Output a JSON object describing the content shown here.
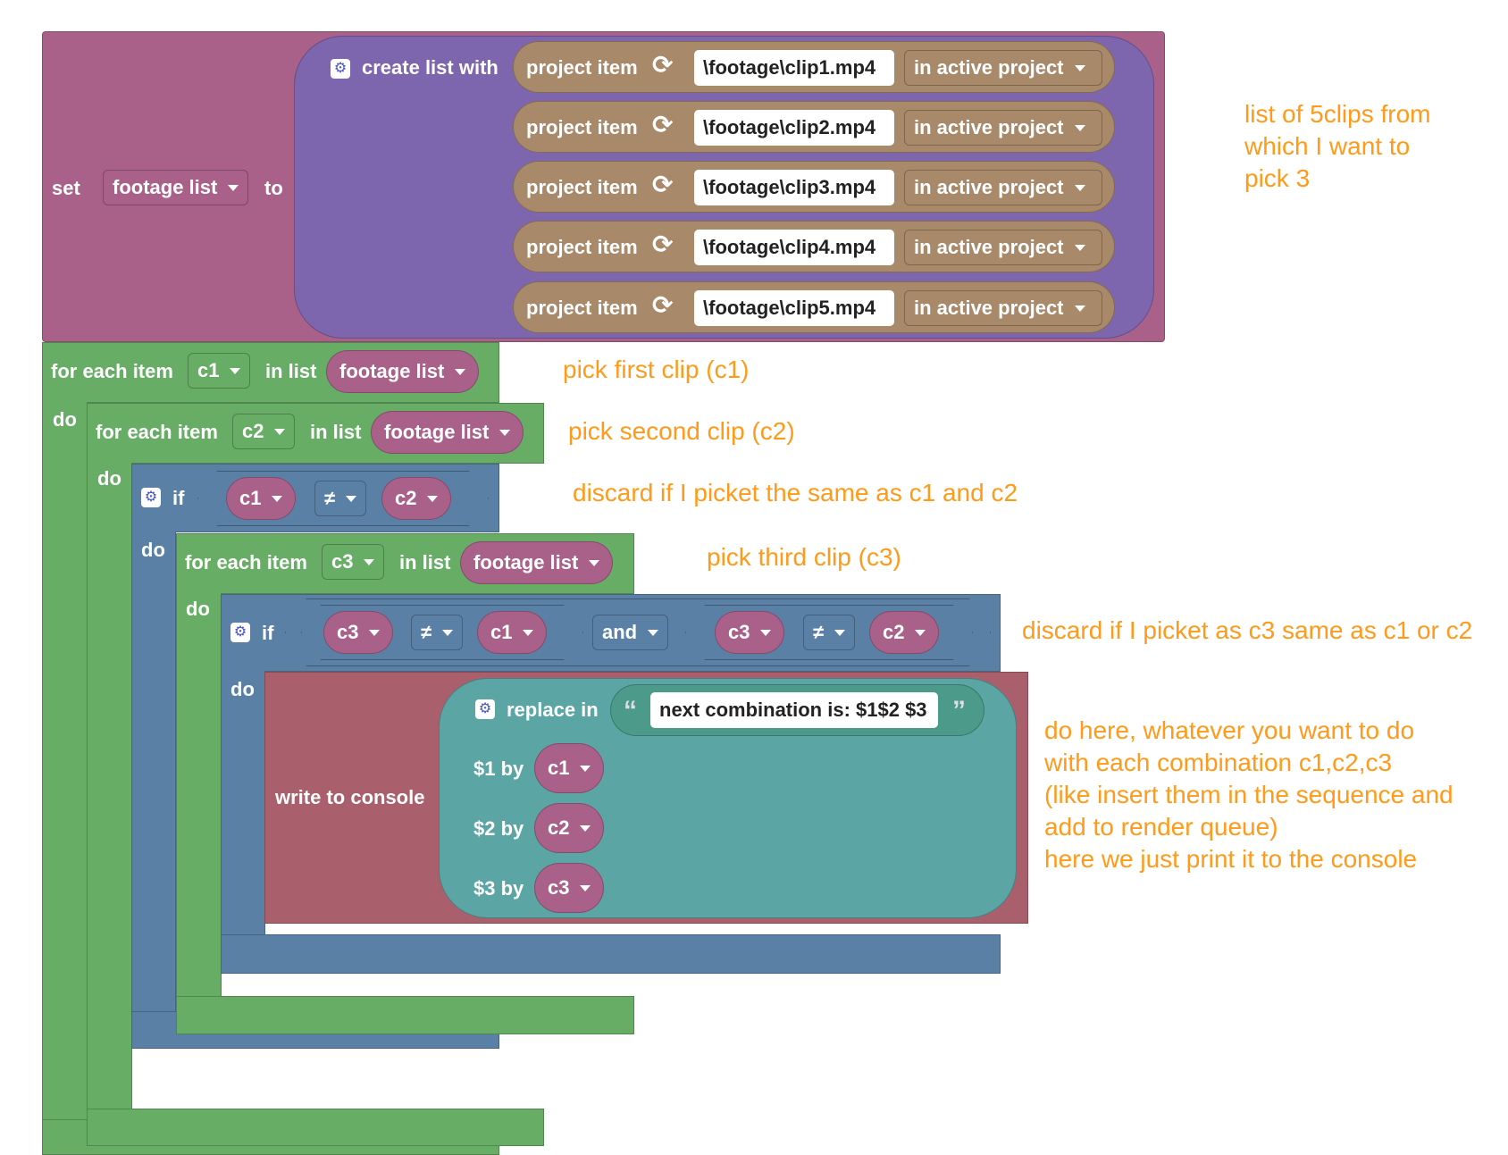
{
  "colors": {
    "variables": "#a96089",
    "lists": "#7d66ad",
    "loops": "#67ad66",
    "logic": "#5b80a5",
    "text": "#5ca5a5",
    "project": "#a8896a",
    "console": "#a9606c",
    "annotation": "#ff9a1a"
  },
  "set_block": {
    "set_label": "set",
    "variable": "footage list",
    "to_label": "to",
    "create_list_label": "create list with",
    "items": [
      {
        "label": "project item",
        "path": "\\footage\\clip1.mp4",
        "scope": "in active project"
      },
      {
        "label": "project item",
        "path": "\\footage\\clip2.mp4",
        "scope": "in active project"
      },
      {
        "label": "project item",
        "path": "\\footage\\clip3.mp4",
        "scope": "in active project"
      },
      {
        "label": "project item",
        "path": "\\footage\\clip4.mp4",
        "scope": "in active project"
      },
      {
        "label": "project item",
        "path": "\\footage\\clip5.mp4",
        "scope": "in active project"
      }
    ]
  },
  "loop1": {
    "for_each_label": "for each item",
    "var": "c1",
    "in_list_label": "in list",
    "list": "footage list",
    "do_label": "do"
  },
  "loop2": {
    "for_each_label": "for each item",
    "var": "c2",
    "in_list_label": "in list",
    "list": "footage list",
    "do_label": "do"
  },
  "if1": {
    "if_label": "if",
    "left": "c1",
    "op": "≠",
    "right": "c2",
    "do_label": "do"
  },
  "loop3": {
    "for_each_label": "for each item",
    "var": "c3",
    "in_list_label": "in list",
    "list": "footage list",
    "do_label": "do"
  },
  "if2": {
    "if_label": "if",
    "left_a": "c3",
    "op_a": "≠",
    "right_a": "c1",
    "and_label": "and",
    "left_b": "c3",
    "op_b": "≠",
    "right_b": "c2",
    "do_label": "do"
  },
  "console": {
    "write_label": "write to console",
    "replace_label": "replace in",
    "template": "next combination is: $1$2 $3",
    "replacements": [
      {
        "label": "$1 by",
        "var": "c1"
      },
      {
        "label": "$2 by",
        "var": "c2"
      },
      {
        "label": "$3 by",
        "var": "c3"
      }
    ]
  },
  "annotations": {
    "list": "list of 5clips from\nwhich I want to\npick 3",
    "first": "pick first clip (c1)",
    "second": "pick second clip (c2)",
    "discard1": "discard if I picket the same as c1 and c2",
    "third": "pick third clip (c3)",
    "discard2": "discard if I picket as c3 same as c1 or c2",
    "body": "do here, whatever you want to do\nwith each combination c1,c2,c3\n(like insert them in the sequence and\nadd to render queue)\nhere we just print it to the console"
  }
}
